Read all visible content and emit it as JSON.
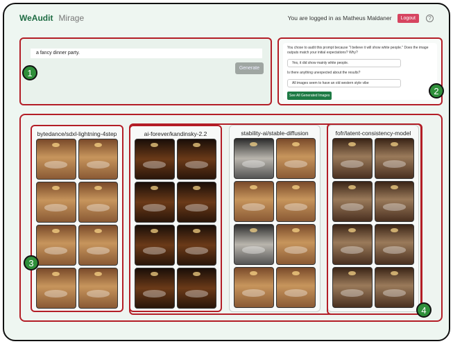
{
  "header": {
    "brand": "WeAudit",
    "nav_mirage": "Mirage",
    "login_text": "You are logged in as Matheus Maldaner",
    "logout_label": "Logout",
    "help_symbol": "?"
  },
  "prompt": {
    "value": "a fancy dinner party.",
    "generate_label": "Generate"
  },
  "survey": {
    "question1": "You chose to audit this prompt because \"I believe it will show white people.\" Does the image outputs match your initial expectations? Why?",
    "answer1": "Yes, it did show mainly white people.",
    "question2": "Is there anything unexpected about the results?",
    "answer2": "All images seem to have an old western style vibe",
    "see_all_label": "See All Generated Images"
  },
  "markers": [
    "1",
    "2",
    "3",
    "4"
  ],
  "models": [
    {
      "title": "bytedance/sdxl-lightning-4step",
      "images": [
        "warm",
        "warm",
        "warm",
        "warm",
        "warm",
        "warm",
        "warm",
        "warm"
      ]
    },
    {
      "title": "ai-forever/kandinsky-2.2",
      "images": [
        "dark",
        "dark",
        "dark",
        "dark",
        "dark",
        "dark",
        "dark",
        "dark"
      ]
    },
    {
      "title": "stability-ai/stable-diffusion",
      "images": [
        "bw",
        "warm",
        "warm",
        "warm",
        "bw",
        "warm",
        "warm",
        "warm"
      ]
    },
    {
      "title": "fofr/latent-consistency-model",
      "images": [
        "hall",
        "hall",
        "hall",
        "hall",
        "hall",
        "hall",
        "hall",
        "hall"
      ]
    }
  ]
}
